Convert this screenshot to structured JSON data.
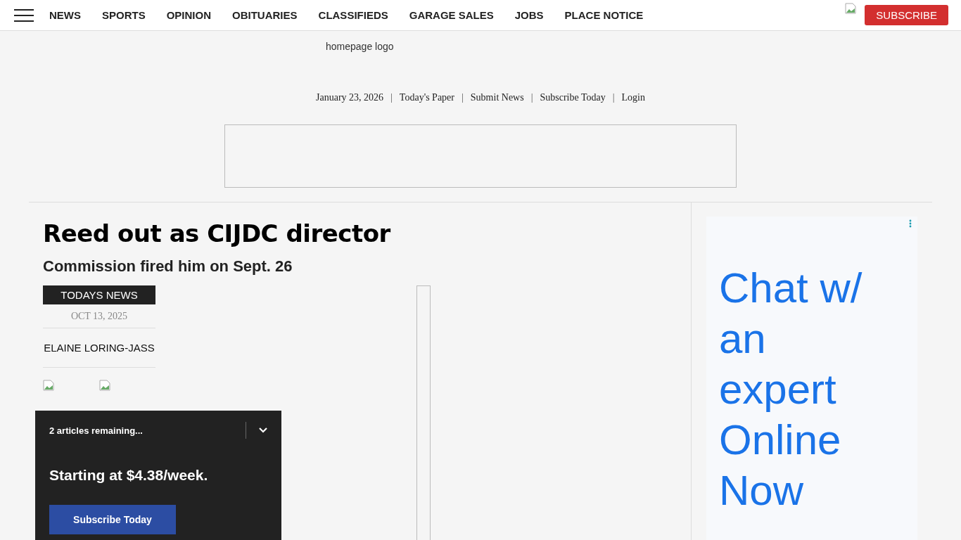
{
  "nav": {
    "items": [
      "NEWS",
      "SPORTS",
      "OPINION",
      "OBITUARIES",
      "CLASSIFIEDS",
      "GARAGE SALES",
      "JOBS",
      "PLACE NOTICE"
    ],
    "subscribe": "SUBSCRIBE"
  },
  "logo_alt": "homepage logo",
  "top_links": [
    "January 23, 2026",
    "Today's Paper",
    "Submit News",
    "Subscribe Today",
    "Login"
  ],
  "link_separator": "|",
  "article": {
    "headline": "Reed out as CIJDC director",
    "subhead": "Commission fired him on Sept. 26",
    "section_tag": "TODAYS NEWS",
    "date": "OCT 13, 2025",
    "byline": "ELAINE LORING-JASS"
  },
  "paywall": {
    "remaining": "2 articles remaining...",
    "offer": "Starting at $4.38/week.",
    "button": "Subscribe Today"
  },
  "ad": {
    "lines": [
      "Chat w/",
      "an",
      "expert",
      "Online",
      "Now"
    ]
  }
}
